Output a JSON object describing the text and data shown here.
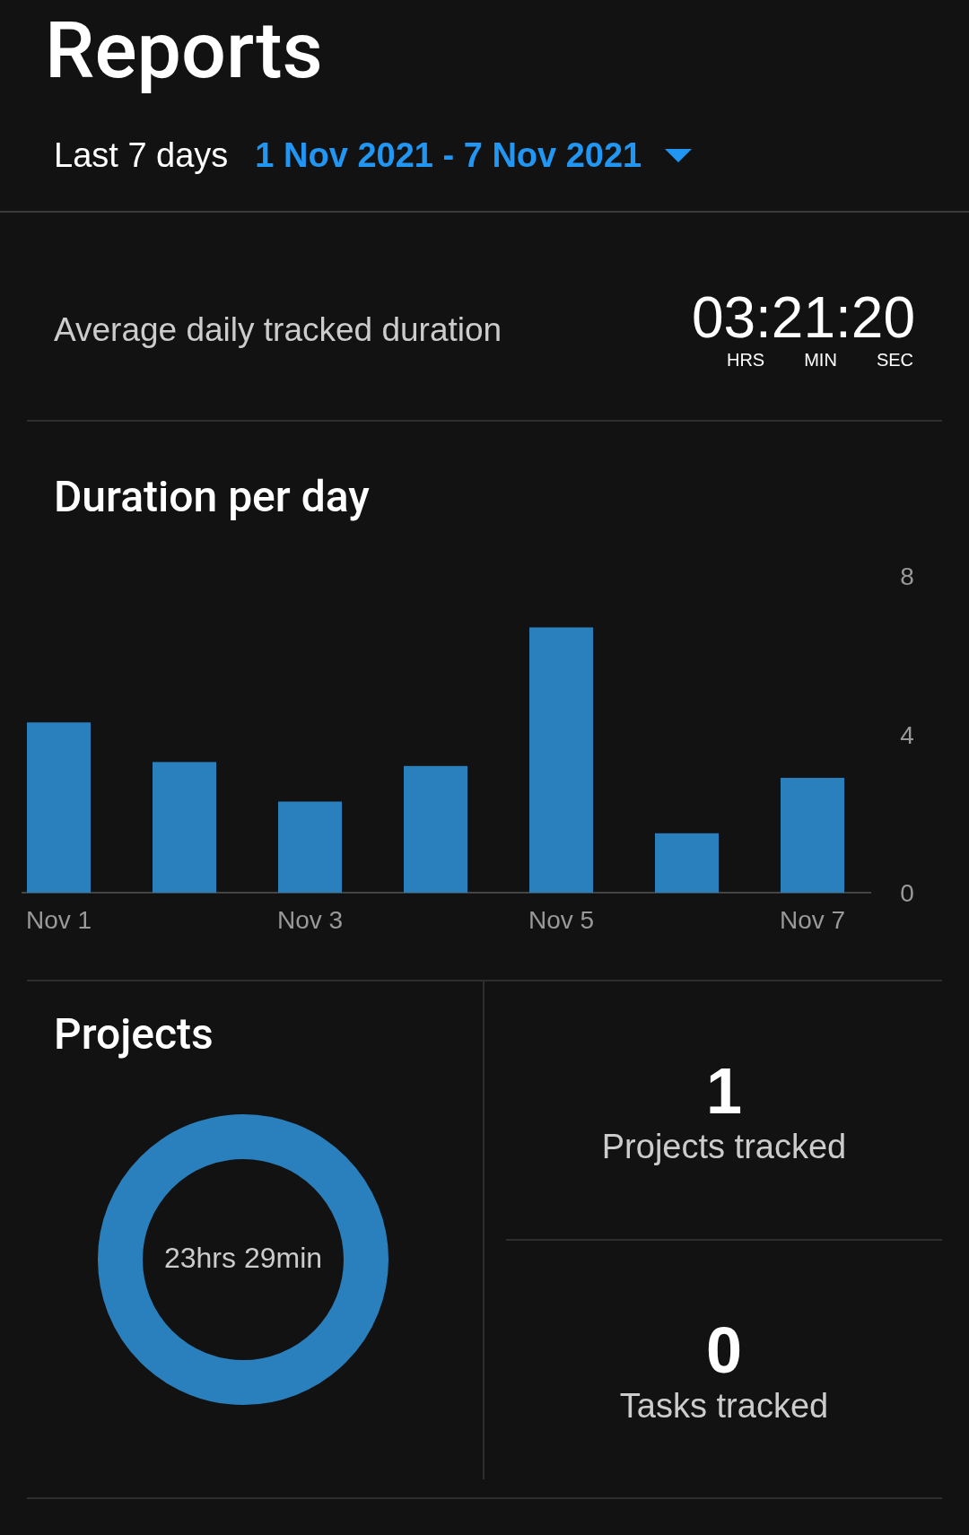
{
  "title": "Reports",
  "range": {
    "label": "Last 7 days",
    "dates": "1 Nov 2021 - 7 Nov 2021"
  },
  "average": {
    "label": "Average daily tracked duration",
    "value": "03:21:20",
    "units": [
      "HRS",
      "MIN",
      "SEC"
    ]
  },
  "duration_chart": {
    "title": "Duration per day",
    "chart_data": {
      "type": "bar",
      "categories": [
        "Nov 1",
        null,
        "Nov 3",
        null,
        "Nov 5",
        null,
        "Nov 7"
      ],
      "values": [
        4.3,
        3.3,
        2.3,
        3.2,
        6.7,
        1.5,
        2.9
      ],
      "ylim": [
        0,
        8
      ],
      "yticks": [
        0,
        4,
        8
      ]
    }
  },
  "projects": {
    "title": "Projects",
    "total": "23hrs 29min",
    "color": "#2a80bd"
  },
  "stats": [
    {
      "value": "1",
      "label": "Projects tracked"
    },
    {
      "value": "0",
      "label": "Tasks tracked"
    }
  ]
}
